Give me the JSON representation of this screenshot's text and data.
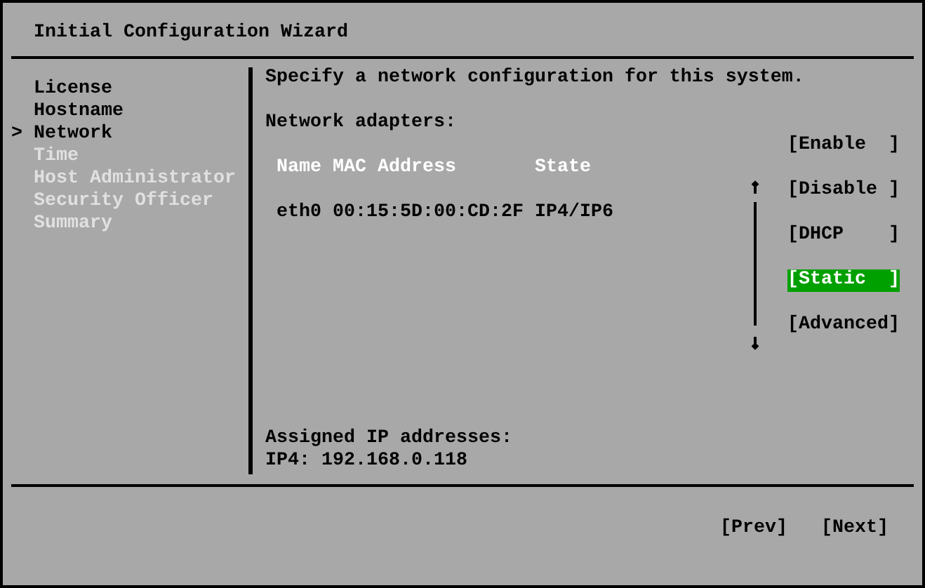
{
  "window": {
    "title": "Initial Configuration Wizard"
  },
  "sidebar": {
    "marker": ">",
    "items": [
      {
        "label": "License",
        "selected": false,
        "disabled": false
      },
      {
        "label": "Hostname",
        "selected": false,
        "disabled": false
      },
      {
        "label": "Network",
        "selected": true,
        "disabled": false
      },
      {
        "label": "Time",
        "selected": false,
        "disabled": true
      },
      {
        "label": "Host Administrator",
        "selected": false,
        "disabled": true
      },
      {
        "label": "Security Officer",
        "selected": false,
        "disabled": true
      },
      {
        "label": "Summary",
        "selected": false,
        "disabled": true
      }
    ]
  },
  "content": {
    "instruction": "Specify a network configuration for this system.",
    "adapters_label": "Network adapters:",
    "table": {
      "columns": [
        "Name",
        "MAC Address",
        "State"
      ],
      "rows": [
        [
          "eth0",
          "00:15:5D:00:CD:2F",
          "IP4/IP6"
        ]
      ]
    },
    "actions": [
      {
        "label": "[Enable  ]",
        "selected": false
      },
      {
        "label": "[Disable ]",
        "selected": false
      },
      {
        "label": "[DHCP    ]",
        "selected": false
      },
      {
        "label": "[Static  ]",
        "selected": true
      },
      {
        "label": "[Advanced]",
        "selected": false
      }
    ],
    "assigned_label": "Assigned IP addresses:",
    "assigned_lines": [
      "IP4: 192.168.0.118"
    ]
  },
  "footer": {
    "buttons": [
      "[Prev]",
      "[Next]"
    ]
  }
}
